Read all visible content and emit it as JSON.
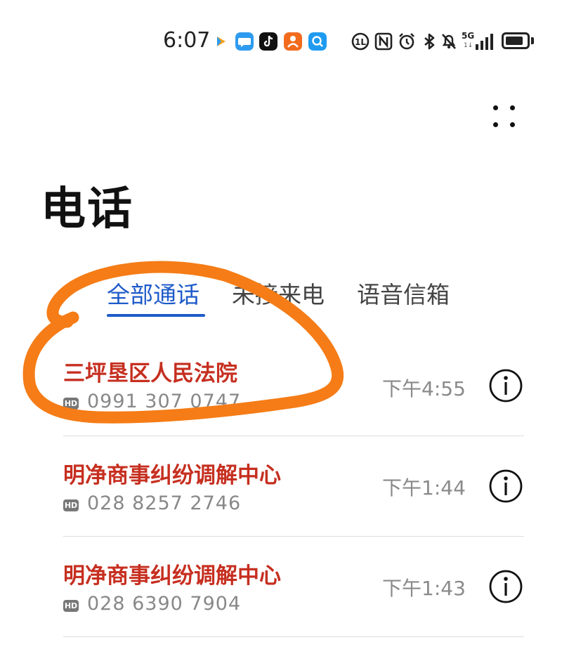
{
  "status_bar": {
    "time": "6:07",
    "network_label": "5G",
    "network_sub": "1↓",
    "battery_level": 0.85,
    "app_icons": [
      {
        "name": "prime-video-icon",
        "color": "#F7A21B"
      },
      {
        "name": "messages-icon",
        "color": "#2E9BF0"
      },
      {
        "name": "tiktok-icon",
        "color": "#111111"
      },
      {
        "name": "xiaohongshu-icon",
        "color": "#F26B1D"
      },
      {
        "name": "search-app-icon",
        "color": "#1E9BF0"
      }
    ],
    "system_icons": [
      "volte-icon",
      "nfc-icon",
      "alarm-icon",
      "bluetooth-icon",
      "mute-icon"
    ]
  },
  "page": {
    "title": "电话"
  },
  "tabs": [
    {
      "label": "全部通话",
      "active": true
    },
    {
      "label": "未接来电",
      "active": false
    },
    {
      "label": "语音信箱",
      "active": false
    }
  ],
  "calls": [
    {
      "name": "三坪垦区人民法院",
      "hd": "HD",
      "number": "0991 307 0747",
      "time": "下午4:55"
    },
    {
      "name": "明净商事纠纷调解中心",
      "hd": "HD",
      "number": "028 8257 2746",
      "time": "下午1:44"
    },
    {
      "name": "明净商事纠纷调解中心",
      "hd": "HD",
      "number": "028 6390 7904",
      "time": "下午1:43"
    }
  ],
  "colors": {
    "accent": "#1E5BC9",
    "missed_call": "#C62F20",
    "annotation": "#F57C16"
  }
}
